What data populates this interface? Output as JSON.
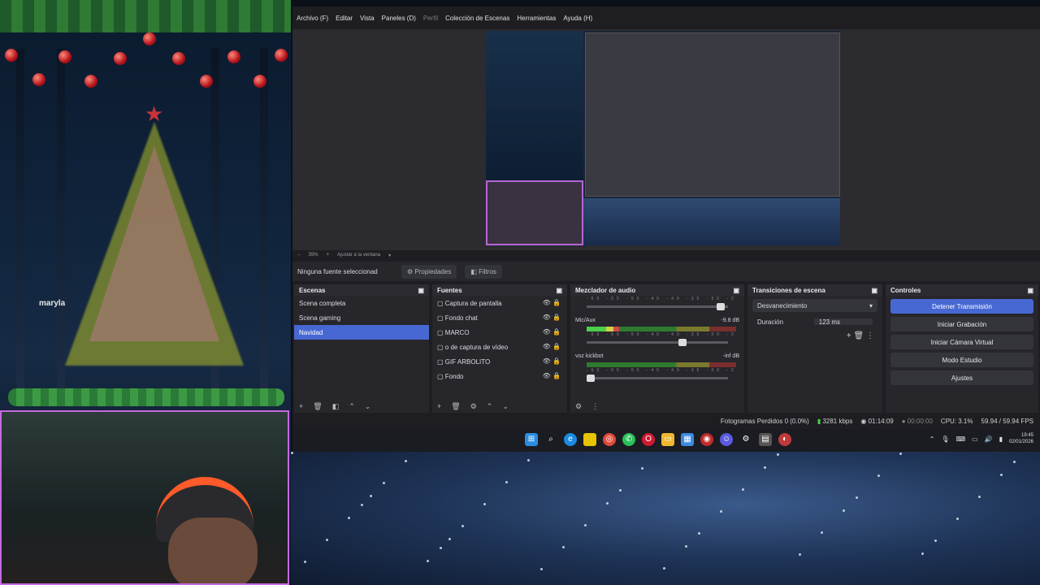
{
  "stream_overlay": {
    "label": "maryla"
  },
  "menu": {
    "items": [
      "Archivo (F)",
      "Editar",
      "Vista",
      "Paneles (D)",
      "Perfil",
      "Colección de Escenas",
      "Herramientas",
      "Ayuda (H)"
    ],
    "disabled_item": "Perfil"
  },
  "zoom": {
    "level": "39%",
    "fit_label": "Ajustar a la ventana"
  },
  "properties_bar": {
    "status": "Ninguna fuente seleccionad",
    "properties_label": "Propiedades",
    "filters_label": "Filtros"
  },
  "scenes": {
    "title": "Escenas",
    "items": [
      "Scena completa",
      "Scena gaming",
      "Navidad"
    ],
    "selected_index": 2
  },
  "sources": {
    "title": "Fuentes",
    "items": [
      "Captura de pantalla",
      "Fondo chat",
      "MARCO",
      "Dispositivo de captura de vídeo",
      "GIF ARBOLITO",
      "Fondo"
    ],
    "visible_labels": [
      "Captura de pantalla",
      "Fondo chat",
      "MARCO",
      "o de captura de vídeo",
      "GIF ARBOLITO",
      "Fondo"
    ]
  },
  "mixer": {
    "title": "Mezclador de audio",
    "scale": "-60 -55 -50 -45 -40 -35 -30 -25 -20 -15 -10 -5 0",
    "channels": [
      {
        "name": "",
        "db": "",
        "level": 0.0,
        "volume": 0.92
      },
      {
        "name": "Mic/Aux",
        "db": "-9.8 dB",
        "level": 0.22,
        "volume": 0.65
      },
      {
        "name": "voz kickbot",
        "db": "-inf dB",
        "level": 0.0,
        "volume": 0.05
      }
    ]
  },
  "transitions": {
    "title": "Transiciones de escena",
    "selected": "Desvanecimiento",
    "duration_label": "Duración",
    "duration_value": "123 ms"
  },
  "controls": {
    "title": "Controles",
    "buttons": [
      "Detener Transmisión",
      "Iniciar Grabación",
      "Iniciar Cámara Virtual",
      "Modo Estudio",
      "Ajustes"
    ]
  },
  "status": {
    "dropped": "Fotogramas Perdidos 0 (0.0%)",
    "bitrate": "3281 kbps",
    "stream_time": "01:14:09",
    "rec_time": "00:00:00",
    "cpu": "CPU: 3.1%",
    "fps": "59.94 / 59.94 FPS"
  },
  "taskbar": {
    "time": "19:45",
    "date": "02/01/2026"
  },
  "colors": {
    "accent": "#4768d3",
    "live_green": "#4ad04a",
    "webcam_border": "#c46ae0"
  }
}
